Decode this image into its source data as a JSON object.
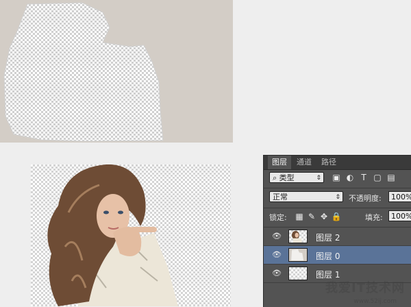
{
  "panel": {
    "tabs": [
      "图层",
      "通道",
      "路径"
    ],
    "filter": {
      "label": "类型",
      "icon": "search-icon"
    },
    "blend_mode": "正常",
    "opacity": {
      "label": "不透明度:",
      "value": "100%"
    },
    "lock_label": "锁定:",
    "fill": {
      "label": "填充:",
      "value": "100%"
    },
    "layers": [
      {
        "name": "图层 2",
        "visible": true,
        "selected": false
      },
      {
        "name": "图层 0",
        "visible": true,
        "selected": true
      },
      {
        "name": "图层 1",
        "visible": true,
        "selected": false
      }
    ]
  },
  "watermark": {
    "text": "我爱IT技术网",
    "url": "www.52ij.com"
  }
}
